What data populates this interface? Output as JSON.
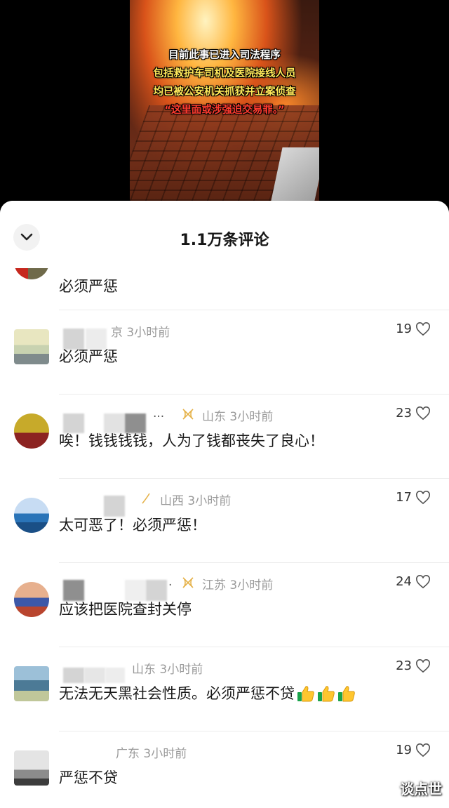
{
  "video": {
    "caption": [
      "目前此事已进入司法程序",
      "包括救护车司机及医院接线人员",
      "均已被公安机关抓获并立案侦查",
      "“这里面或涉强迫交易罪。”"
    ]
  },
  "panel": {
    "title": "1.1万条评论",
    "collapse_icon": "chevron-down-icon"
  },
  "comments": [
    {
      "meta": "",
      "text": "必须严惩",
      "likes": ""
    },
    {
      "meta": "京 3小时前",
      "text": "必须严惩",
      "likes": "19"
    },
    {
      "meta": "山东 3小时前",
      "ellipsis": "...",
      "text": "唉！钱钱钱钱，人为了钱都丧失了良心！",
      "likes": "23"
    },
    {
      "meta": "山西 3小时前",
      "text": "太可恶了！必须严惩！",
      "likes": "17"
    },
    {
      "meta": "江苏 3小时前",
      "ellipsis": ".",
      "text": "应该把医院查封关停",
      "likes": "24"
    },
    {
      "meta": "山东 3小时前",
      "text": "无法无天黑社会性质。必须严惩不贷",
      "likes": "23"
    },
    {
      "meta": "广东 3小时前",
      "text": "严惩不贷",
      "likes": "19"
    }
  ],
  "watermark": "谈点世"
}
